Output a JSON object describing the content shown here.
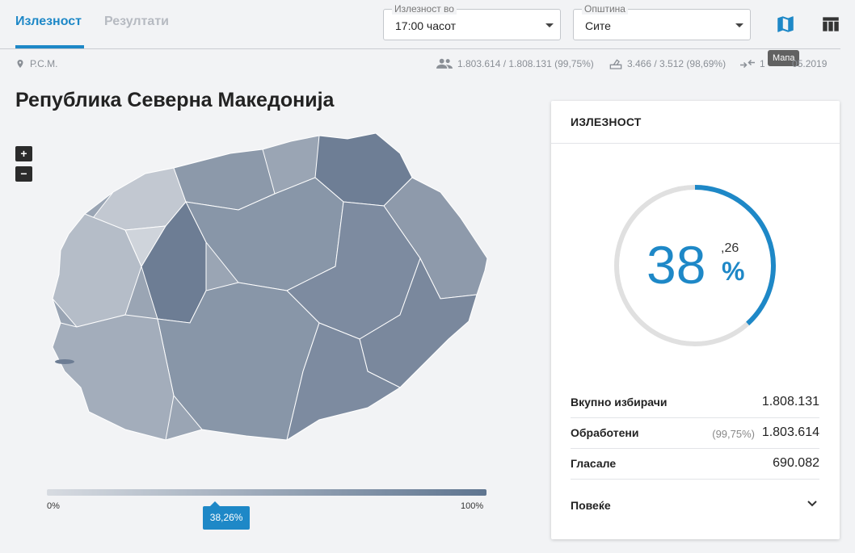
{
  "tabs": [
    {
      "label": "Излезност",
      "active": true
    },
    {
      "label": "Резултати",
      "active": false
    }
  ],
  "filters": {
    "turnout_time": {
      "legend": "Излезност во",
      "value": "17:00 часот"
    },
    "municipality": {
      "legend": "Општина",
      "value": "Сите"
    }
  },
  "toolbar": {
    "map_icon": "map-icon",
    "table_icon": "table-icon",
    "tooltip": "Мапа"
  },
  "subline": {
    "location": "Р.С.М.",
    "voters_text": "1.803.614 / 1.808.131 (99,75%)",
    "stations_text": "3.466 / 3.512 (98,69%)",
    "date_text": "1          05.2019"
  },
  "page_title": "Република Северна Македонија",
  "map": {
    "zoom_in": "+",
    "zoom_out": "−",
    "color_low": "#d7dbe1",
    "color_high": "#5f7590"
  },
  "legend": {
    "min_label": "0%",
    "max_label": "100%",
    "marker_label": "38,26%",
    "marker_value": 38.26
  },
  "card": {
    "title": "ИЗЛЕЗНОСТ",
    "turnout_percent": 38.26,
    "turnout_int": "38",
    "turnout_dec": ",26",
    "turnout_unit": "%",
    "accent_color": "#1e88c7",
    "stats": [
      {
        "label": "Вкупно избирачи",
        "value": "1.808.131",
        "pct": ""
      },
      {
        "label": "Обработени",
        "value": "1.803.614",
        "pct": "(99,75%)"
      },
      {
        "label": "Гласале",
        "value": "690.082",
        "pct": ""
      }
    ],
    "more_label": "Повеќе"
  }
}
